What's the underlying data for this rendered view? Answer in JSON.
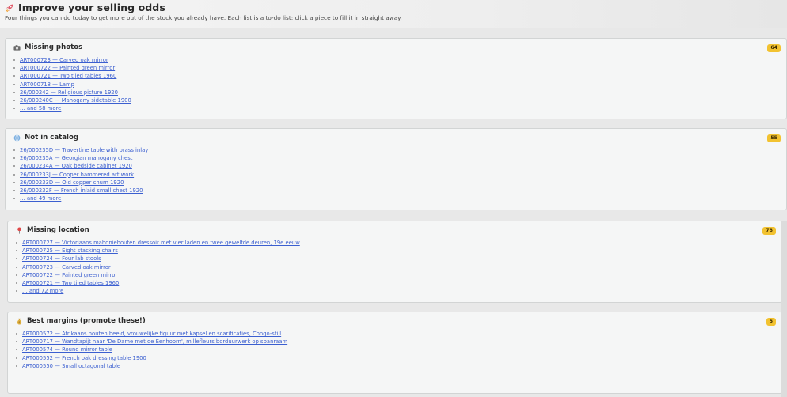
{
  "header": {
    "title": "Improve your selling odds",
    "subtitle": "Four things you can do today to get more out of the stock you already have. Each list is a to-do list: click a piece to fill it in straight away.",
    "icon": "rocket-icon"
  },
  "cards": [
    {
      "title": "Missing photos",
      "icon": "camera-icon",
      "count": "64",
      "items": [
        "ART000723 — Carved oak mirror",
        "ART000722 — Painted green mirror",
        "ART000721 — Two tiled tables 1960",
        "ART000718 — Lamp",
        "26/000242 — Religious picture 1920",
        "26/000240C — Mahogany sidetable 1900",
        "… and 58 more"
      ]
    },
    {
      "title": "Not in catalog",
      "icon": "globe-icon",
      "count": "55",
      "items": [
        "26/000235D — Travertine table with brass inlay",
        "26/000235A — Georgian mahogany chest",
        "26/000234A — Oak bedside cabinet 1920",
        "26/000233J — Copper hammered art work",
        "26/000233D — Old copper churn 1920",
        "26/000232F — French inlaid small chest 1920",
        "… and 49 more"
      ]
    },
    {
      "title": "Missing location",
      "icon": "map-pin-icon",
      "count": "78",
      "items": [
        "ART000727 — Victoriaans mahoniehouten dressoir met vier laden en twee gewelfde deuren, 19e eeuw",
        "ART000725 — Eight stacking chairs",
        "ART000724 — Four lab stools",
        "ART000723 — Carved oak mirror",
        "ART000722 — Painted green mirror",
        "ART000721 — Two tiled tables 1960",
        "… and 72 more"
      ]
    },
    {
      "title": "Best margins (promote these!)",
      "icon": "money-bag-icon",
      "count": "5",
      "items": [
        "ART000572 — Afrikaans houten beeld, vrouwelijke figuur met kapsel en scarificaties, Congo-stijl",
        "ART000717 — Wandtapijt naar 'De Dame met de Eenhoorn', millefleurs borduurwerk op spanraam",
        "ART000574 — Round mirror table",
        "ART000552 — French oak dressing table 1900",
        "ART000550 — Small octagonal table"
      ]
    }
  ],
  "colors": {
    "badge": "#f2c230",
    "link": "#3b5fd0"
  }
}
